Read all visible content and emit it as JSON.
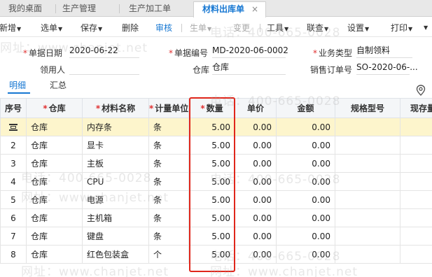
{
  "tabs": [
    {
      "label": "我的桌面"
    },
    {
      "label": "生产管理"
    },
    {
      "label": "生产加工单"
    },
    {
      "label": "材料出库单",
      "close": "×"
    }
  ],
  "toolbar": {
    "new": "新增",
    "select_order": "选单",
    "save": "保存",
    "delete": "删除",
    "audit": "审核",
    "generate": "生单",
    "change": "变更",
    "tools": "工具",
    "linked": "联查",
    "settings": "设置",
    "print": "打印",
    "more": "▼"
  },
  "form": {
    "doc_date_label": "单据日期",
    "doc_date": "2020-06-22",
    "doc_no_label": "单据编号",
    "doc_no": "MD-2020-06-0002",
    "biz_type_label": "业务类型",
    "biz_type": "自制领料",
    "requester_label": "领用人",
    "requester": "",
    "warehouse_label": "仓库",
    "warehouse": "仓库",
    "sales_order_label": "销售订单号",
    "sales_order": "SO-2020-06-..."
  },
  "detail_tabs": {
    "detail": "明细",
    "summary": "汇总"
  },
  "table": {
    "headers": {
      "seq": "序号",
      "warehouse": "仓库",
      "material": "材料名称",
      "unit": "计量单位",
      "qty": "数量",
      "price": "单价",
      "amount": "金额",
      "spec": "规格型号",
      "stock": "现存量"
    },
    "rows": [
      {
        "seq": "",
        "warehouse": "仓库",
        "material": "内存条",
        "unit": "条",
        "qty": "5.00",
        "price": "0.00",
        "amount": "0.00",
        "spec": "",
        "stock": ""
      },
      {
        "seq": "2",
        "warehouse": "仓库",
        "material": "显卡",
        "unit": "条",
        "qty": "5.00",
        "price": "0.00",
        "amount": "0.00",
        "spec": "",
        "stock": ""
      },
      {
        "seq": "3",
        "warehouse": "仓库",
        "material": "主板",
        "unit": "条",
        "qty": "5.00",
        "price": "0.00",
        "amount": "0.00",
        "spec": "",
        "stock": ""
      },
      {
        "seq": "4",
        "warehouse": "仓库",
        "material": "CPU",
        "unit": "条",
        "qty": "5.00",
        "price": "0.00",
        "amount": "0.00",
        "spec": "",
        "stock": ""
      },
      {
        "seq": "5",
        "warehouse": "仓库",
        "material": "电源",
        "unit": "条",
        "qty": "5.00",
        "price": "0.00",
        "amount": "0.00",
        "spec": "",
        "stock": ""
      },
      {
        "seq": "6",
        "warehouse": "仓库",
        "material": "主机箱",
        "unit": "条",
        "qty": "5.00",
        "price": "0.00",
        "amount": "0.00",
        "spec": "",
        "stock": ""
      },
      {
        "seq": "7",
        "warehouse": "仓库",
        "material": "键盘",
        "unit": "条",
        "qty": "5.00",
        "price": "0.00",
        "amount": "0.00",
        "spec": "",
        "stock": ""
      },
      {
        "seq": "8",
        "warehouse": "仓库",
        "material": "红色包装盒",
        "unit": "个",
        "qty": "5.00",
        "price": "0.00",
        "amount": "0.00",
        "spec": "",
        "stock": ""
      }
    ]
  },
  "watermark": {
    "phone": "电话：400-665-0028",
    "site": "网址：www.chanjet.net"
  },
  "colors": {
    "accent": "#1677d2",
    "required": "#e03030",
    "highlight": "#e0261b",
    "selected_row": "#fdf5cc"
  }
}
